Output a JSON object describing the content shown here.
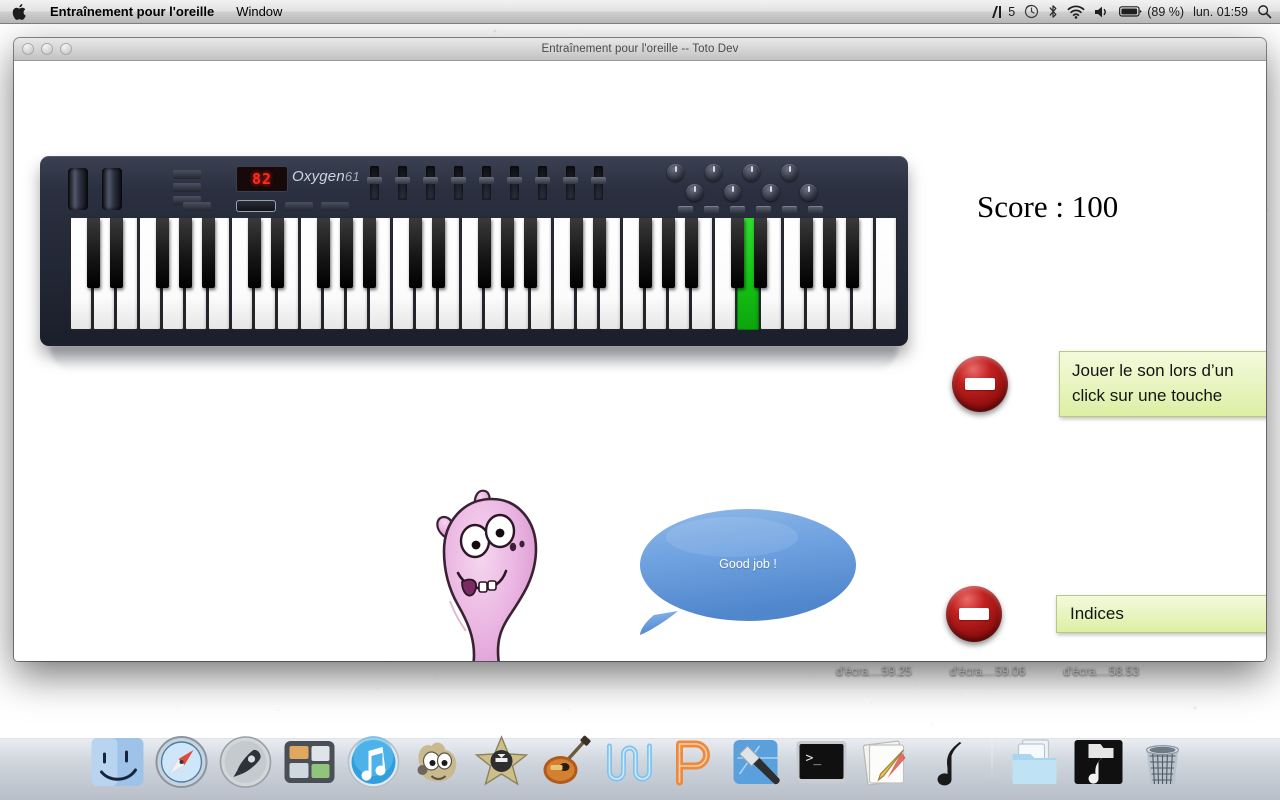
{
  "menubar": {
    "apple_icon": "apple-logo-icon",
    "app_name": "Entraînement pour l'oreille",
    "menus": [
      "Window"
    ],
    "status": {
      "antialias_icon": "a-logo-icon",
      "antialias_count": "5",
      "timemachine_icon": "time-machine-icon",
      "bluetooth_icon": "bluetooth-icon",
      "wifi_icon": "wifi-icon",
      "volume_icon": "volume-icon",
      "battery_icon": "battery-icon",
      "battery_percent": "(89 %)",
      "clock": "lun. 01:59",
      "spotlight_icon": "search-icon"
    }
  },
  "window": {
    "title": "Entraînement pour l'oreille -- Toto Dev",
    "controls": [
      "close-button",
      "minimize-button",
      "zoom-button"
    ]
  },
  "app": {
    "score_label": "Score : 100",
    "keyboard": {
      "name": "oxygen61-midi-keyboard",
      "brand": "Oxygen",
      "model": "61",
      "display_value": "82",
      "active_key_index": 29,
      "active_key_color": "#14c414",
      "white_key_count": 36
    },
    "mascot": {
      "name": "pink-monster-mascot",
      "body_color": "#eab4e0"
    },
    "speech_bubble": {
      "text": "Good job !",
      "color": "#6ba3e0"
    },
    "options": [
      {
        "id": "sound-on-click",
        "button_icon": "red-minus-button",
        "button_color": "#a81414",
        "label": "Jouer le son lors d’un click sur une touche"
      },
      {
        "id": "hints",
        "button_icon": "red-minus-button",
        "button_color": "#a81414",
        "label": "Indices"
      }
    ]
  },
  "desktop": {
    "files": [
      "d'écra....59.25",
      "d'écra....59.06",
      "d'écra....58.53"
    ]
  },
  "dock": {
    "items": [
      {
        "name": "finder-icon",
        "label": "Finder"
      },
      {
        "name": "safari-icon",
        "label": "Safari"
      },
      {
        "name": "launchpad-icon",
        "label": "Launchpad"
      },
      {
        "name": "mission-control-icon",
        "label": "Mission Control"
      },
      {
        "name": "itunes-icon",
        "label": "iTunes"
      },
      {
        "name": "gimp-icon",
        "label": "GIMP"
      },
      {
        "name": "imovie-icon",
        "label": "iMovie"
      },
      {
        "name": "garageband-icon",
        "label": "GarageBand"
      },
      {
        "name": "wave-editor-icon",
        "label": "Wave"
      },
      {
        "name": "pencil-app-icon",
        "label": "P"
      },
      {
        "name": "xcode-icon",
        "label": "Xcode"
      },
      {
        "name": "terminal-icon",
        "label": "Terminal"
      },
      {
        "name": "textedit-icon",
        "label": "TextEdit"
      },
      {
        "name": "music-note-app-icon",
        "label": "Music"
      },
      {
        "name": "documents-stack-icon",
        "label": "Documents"
      },
      {
        "name": "music-folder-icon",
        "label": "Music Folder"
      },
      {
        "name": "trash-icon",
        "label": "Trash"
      }
    ]
  }
}
